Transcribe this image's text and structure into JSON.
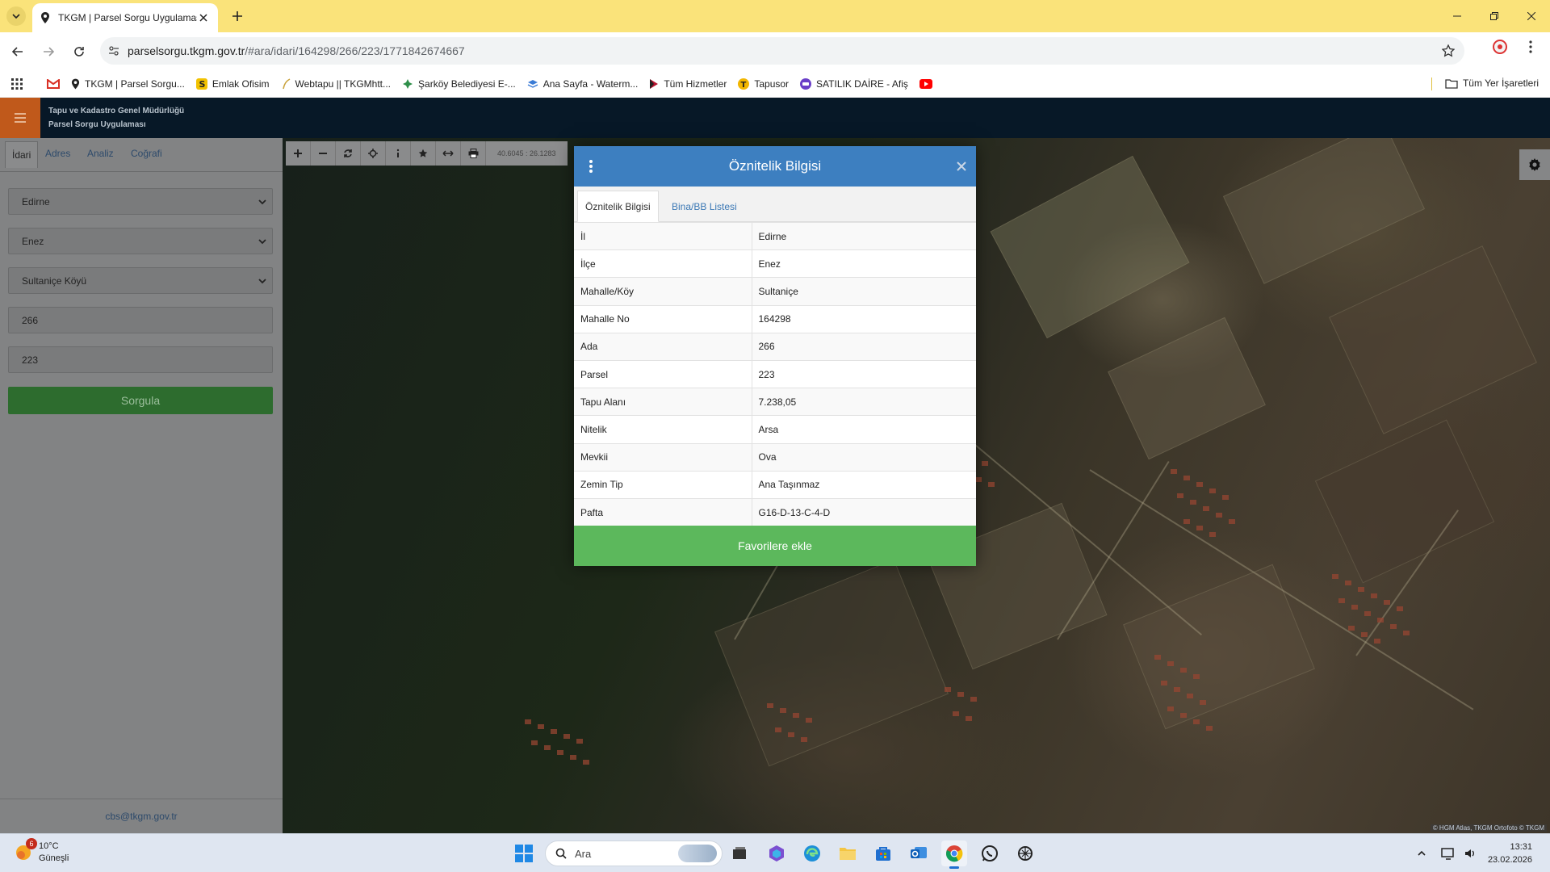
{
  "browser": {
    "tab_title": "TKGM | Parsel Sorgu Uygulaması",
    "url_host": "parselsorgu.tkgm.gov.tr",
    "url_path": "/#ara/idari/164298/266/223/1771842674667"
  },
  "bookmarks": [
    {
      "label": "TKGM | Parsel Sorgu..."
    },
    {
      "label": "Emlak Ofisim"
    },
    {
      "label": "Webtapu || TKGMhtt..."
    },
    {
      "label": "Şarköy Belediyesi E-..."
    },
    {
      "label": "Ana Sayfa - Waterm..."
    },
    {
      "label": "Tüm Hizmetler"
    },
    {
      "label": "Tapusor"
    },
    {
      "label": "SATILIK DAİRE - Afiş"
    }
  ],
  "bookmarks_all": "Tüm Yer İşaretleri",
  "app": {
    "title_line1": "Tapu ve Kadastro Genel Müdürlüğü",
    "title_line2": "Parsel Sorgu Uygulaması"
  },
  "sidebar": {
    "tabs": [
      "İdari",
      "Adres",
      "Analiz",
      "Coğrafi"
    ],
    "il": "Edirne",
    "ilce": "Enez",
    "mahalle": "Sultaniçe Köyü",
    "ada": "266",
    "parsel": "223",
    "query_button": "Sorgula",
    "footer_email": "cbs@tkgm.gov.tr"
  },
  "map": {
    "coordinates": "40.6045 : 26.1283",
    "attribution": "© HGM Atlas, TKGM Ortofoto © TKGM"
  },
  "modal": {
    "title": "Öznitelik Bilgisi",
    "tabs": [
      "Öznitelik Bilgisi",
      "Bina/BB Listesi"
    ],
    "rows": [
      {
        "key": "İl",
        "value": "Edirne"
      },
      {
        "key": "İlçe",
        "value": "Enez"
      },
      {
        "key": "Mahalle/Köy",
        "value": "Sultaniçe"
      },
      {
        "key": "Mahalle No",
        "value": "164298"
      },
      {
        "key": "Ada",
        "value": "266"
      },
      {
        "key": "Parsel",
        "value": "223"
      },
      {
        "key": "Tapu Alanı",
        "value": "7.238,05"
      },
      {
        "key": "Nitelik",
        "value": "Arsa"
      },
      {
        "key": "Mevkii",
        "value": "Ova"
      },
      {
        "key": "Zemin Tip",
        "value": "Ana Taşınmaz"
      },
      {
        "key": "Pafta",
        "value": "G16-D-13-C-4-D"
      }
    ],
    "favorite_button": "Favorilere ekle"
  },
  "taskbar": {
    "weather_temp": "10°C",
    "weather_desc": "Güneşli",
    "weather_badge": "6",
    "search_placeholder": "Ara",
    "time": "13:31",
    "date": "23.02.2026"
  },
  "colors": {
    "tabstrip": "#fae37a",
    "app_header": "#071827",
    "hamburger": "#c0591b",
    "modal_header": "#3d7fc0",
    "favorite_button": "#5cb85c",
    "query_button": "#2d6c2e"
  }
}
